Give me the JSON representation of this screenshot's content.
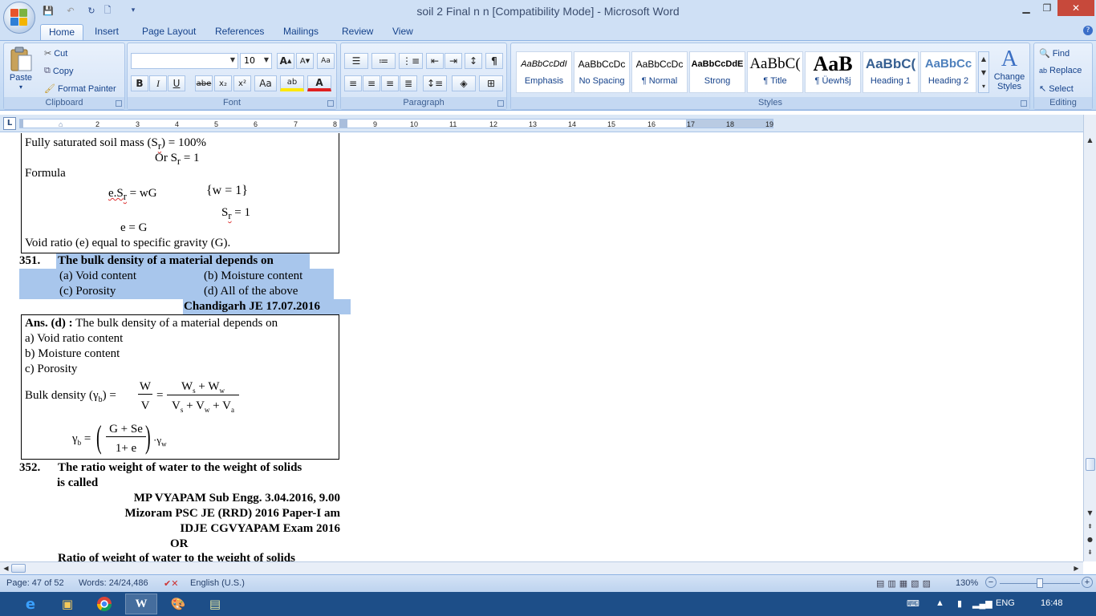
{
  "window": {
    "title": "soil 2  Final n n [Compatibility Mode] - Microsoft Word",
    "minimize": "▁",
    "restore": "❐",
    "close": "✕"
  },
  "qat": {
    "save": "💾",
    "undo": "↶",
    "redo": "↻",
    "new_doc": "🗋",
    "more": "▾"
  },
  "tabs": [
    "Home",
    "Insert",
    "Page Layout",
    "References",
    "Mailings",
    "Review",
    "View"
  ],
  "ribbon": {
    "clipboard": {
      "label": "Clipboard",
      "paste": "Paste",
      "cut": "Cut",
      "copy": "Copy",
      "format_painter": "Format Painter"
    },
    "font": {
      "label": "Font",
      "font_name": "",
      "font_size": "10",
      "grow": "A",
      "shrink": "A",
      "clear": "Aa",
      "bold": "B",
      "italic": "I",
      "underline": "U",
      "strike": "abe",
      "subscript": "x₂",
      "superscript": "x²",
      "change_case": "Aa",
      "highlight": "ab",
      "font_color": "A"
    },
    "paragraph": {
      "label": "Paragraph",
      "show_marks": "¶"
    },
    "styles": {
      "label": "Styles",
      "items": [
        {
          "sample": "AaBbCcDdI",
          "name": "Emphasis"
        },
        {
          "sample": "AaBbCcDc",
          "name": "No Spacing"
        },
        {
          "sample": "AaBbCcDc",
          "name": "¶ Normal"
        },
        {
          "sample": "AaBbCcDdE",
          "name": "Strong"
        },
        {
          "sample": "AaBbC(",
          "name": "¶ Title"
        },
        {
          "sample": "AaB",
          "name": "¶ Üewhšj"
        },
        {
          "sample": "AaBbC(",
          "name": "Heading 1"
        },
        {
          "sample": "AaBbCc",
          "name": "Heading 2"
        }
      ],
      "change_styles": "Change Styles"
    },
    "editing": {
      "label": "Editing",
      "find": "Find",
      "replace": "Replace",
      "select": "Select"
    }
  },
  "ruler": {
    "corner": "L",
    "ticks": [
      "1",
      "2",
      "3",
      "4",
      "5",
      "6",
      "7",
      "8",
      "9",
      "10",
      "11",
      "12",
      "13",
      "14",
      "15",
      "16",
      "17",
      "18",
      "19"
    ]
  },
  "document": {
    "box1": {
      "line1": "Fully saturated soil mass (S",
      "line1_sub": "r",
      "line1_end": ") = 100%",
      "line2": "Or S",
      "line2_sub": "r",
      "line2_end": " = 1",
      "formula_label": "Formula",
      "eq1": "e.S",
      "eq1_sub": "r",
      "eq1_end": " = wG",
      "eq_brace": "{w = 1}",
      "eq2": "S",
      "eq2_sub": "r",
      "eq2_end": " = 1",
      "eq3": "e = G",
      "conclusion": "Void ratio (e) equal to specific gravity (G)."
    },
    "q351": {
      "number": "351.",
      "question": "The bulk density of a material depends on",
      "opt_a": "(a)  Void content",
      "opt_b": "(b)  Moisture content",
      "opt_c": "(c)  Porosity",
      "opt_d": "(d)  All of the above",
      "source": "Chandigarh JE 17.07.2016"
    },
    "ans351": {
      "ans_label": "Ans. (d) :",
      "ans_text": " The bulk density of a material depends on",
      "a": "a) Void ratio content",
      "b": "b) Moisture content",
      "c": "c) Porosity",
      "bulk_label": "Bulk density (γ",
      "bulk_sub": "b",
      "bulk_end": ") =",
      "frac1_num": "W",
      "frac1_den": "V",
      "frac2_num": "W",
      "frac2_num_sub1": "s",
      "frac2_num_plus": " + W",
      "frac2_num_sub2": "w",
      "frac2_den": "V",
      "frac2_den_sub1": "s",
      "frac2_den_mid": " + V",
      "frac2_den_sub2": "w",
      "frac2_den_plus": " + V",
      "frac2_den_sub3": "a",
      "gamma_b": "γ",
      "gamma_b_sub": "b",
      "eq": " =",
      "frac3_num": "G + Se",
      "frac3_den": "1+ e",
      "gamma_w": "·γ",
      "gamma_w_sub": "w"
    },
    "q352": {
      "number": "352.",
      "question_l1": "The ratio weight of water to the weight of solids",
      "question_l2": "is called",
      "src1": "MP VYAPAM Sub Engg. 3.04.2016, 9.00",
      "src2": "Mizoram PSC JE (RRD) 2016 Paper-I am",
      "src3": "IDJE CGVYAPAM Exam 2016",
      "or": "OR",
      "next_line": "Ratio  of weight of water to the weight of solids"
    }
  },
  "statusbar": {
    "page": "Page: 47 of 52",
    "words": "Words: 24/24,486",
    "language": "English (U.S.)",
    "zoom": "130%",
    "zoom_minus": "−",
    "zoom_plus": "+"
  },
  "taskbar": {
    "lang": "ENG",
    "time": "16:48"
  }
}
